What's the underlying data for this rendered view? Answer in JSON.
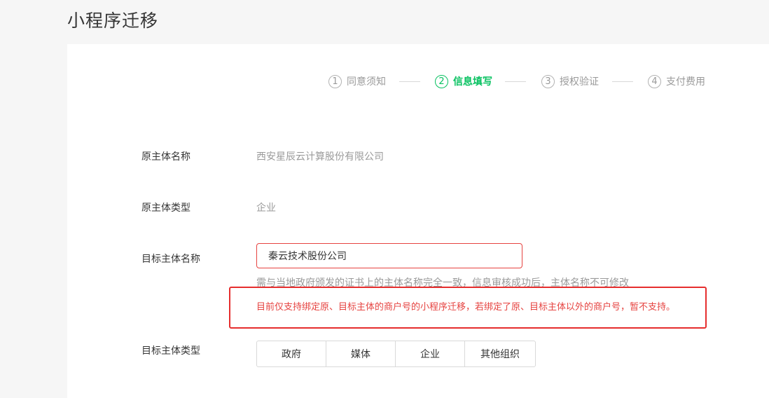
{
  "page": {
    "title": "小程序迁移"
  },
  "steps": [
    {
      "num": "1",
      "label": "同意须知",
      "active": false
    },
    {
      "num": "2",
      "label": "信息填写",
      "active": true
    },
    {
      "num": "3",
      "label": "授权验证",
      "active": false
    },
    {
      "num": "4",
      "label": "支付费用",
      "active": false
    }
  ],
  "form": {
    "original_name": {
      "label": "原主体名称",
      "value": "西安星辰云计算股份有限公司"
    },
    "original_type": {
      "label": "原主体类型",
      "value": "企业"
    },
    "target_name": {
      "label": "目标主体名称",
      "value": "秦云技术股份公司",
      "hint": "需与当地政府颁发的证书上的主体名称完全一致，信息审核成功后，主体名称不可修改",
      "warning": "目前仅支持绑定原、目标主体的商户号的小程序迁移，若绑定了原、目标主体以外的商户号，暂不支持。"
    },
    "target_type": {
      "label": "目标主体类型",
      "options": [
        "政府",
        "媒体",
        "企业",
        "其他组织"
      ]
    }
  },
  "colors": {
    "accent": "#07c160",
    "error": "#e64340",
    "annotation_box": "#e62e2e"
  }
}
